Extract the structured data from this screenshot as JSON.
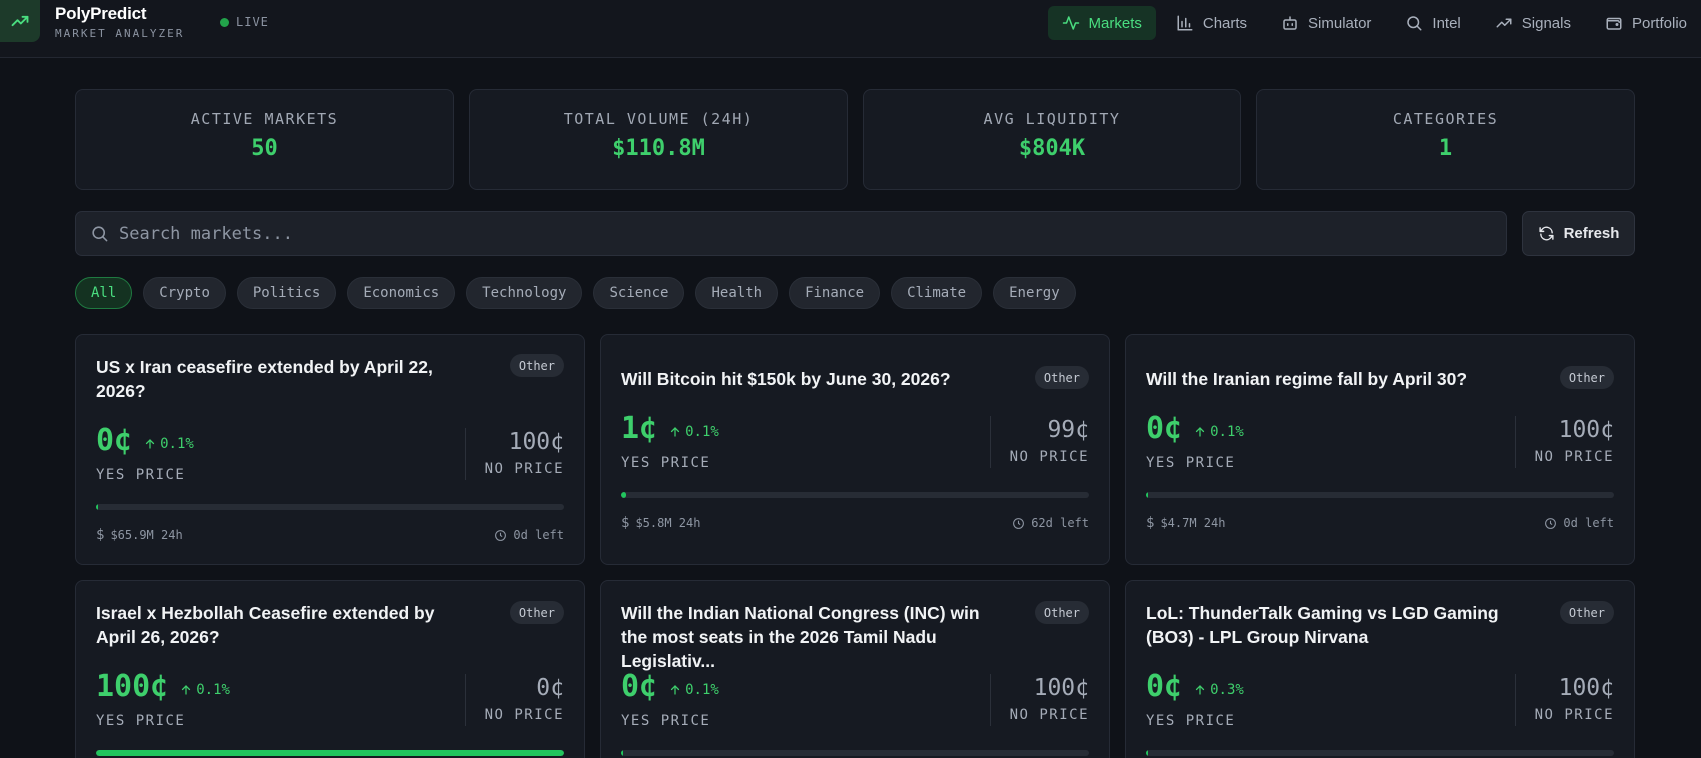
{
  "app": {
    "name": "PolyPredict",
    "subtitle": "MARKET ANALYZER",
    "live_label": "LIVE"
  },
  "nav": [
    {
      "label": "Markets",
      "icon": "activity-icon",
      "active": true
    },
    {
      "label": "Charts",
      "icon": "bar-chart-icon",
      "active": false
    },
    {
      "label": "Simulator",
      "icon": "bot-icon",
      "active": false
    },
    {
      "label": "Intel",
      "icon": "search-icon",
      "active": false
    },
    {
      "label": "Signals",
      "icon": "trending-up-icon",
      "active": false
    },
    {
      "label": "Portfolio",
      "icon": "wallet-icon",
      "active": false
    }
  ],
  "stats": [
    {
      "label": "ACTIVE MARKETS",
      "value": "50"
    },
    {
      "label": "TOTAL VOLUME (24H)",
      "value": "$110.8M"
    },
    {
      "label": "AVG LIQUIDITY",
      "value": "$804K"
    },
    {
      "label": "CATEGORIES",
      "value": "1"
    }
  ],
  "search": {
    "placeholder": "Search markets...",
    "value": ""
  },
  "refresh_label": "Refresh",
  "categories": [
    "All",
    "Crypto",
    "Politics",
    "Economics",
    "Technology",
    "Science",
    "Health",
    "Finance",
    "Climate",
    "Energy"
  ],
  "active_category": "All",
  "markets": [
    {
      "title": "US x Iran ceasefire extended by April 22, 2026?",
      "badge": "Other",
      "yes_price": "0¢",
      "change": "0.1%",
      "yes_label": "YES PRICE",
      "no_price": "100¢",
      "no_label": "NO PRICE",
      "yes_fraction": 0.0,
      "volume": "$65.9M 24h",
      "time_left": "0d left"
    },
    {
      "title": "Will Bitcoin hit $150k by June 30, 2026?",
      "badge": "Other",
      "yes_price": "1¢",
      "change": "0.1%",
      "yes_label": "YES PRICE",
      "no_price": "99¢",
      "no_label": "NO PRICE",
      "yes_fraction": 0.01,
      "volume": "$5.8M 24h",
      "time_left": "62d left"
    },
    {
      "title": "Will the Iranian regime fall by April 30?",
      "badge": "Other",
      "yes_price": "0¢",
      "change": "0.1%",
      "yes_label": "YES PRICE",
      "no_price": "100¢",
      "no_label": "NO PRICE",
      "yes_fraction": 0.0,
      "volume": "$4.7M 24h",
      "time_left": "0d left"
    },
    {
      "title": "Israel x Hezbollah Ceasefire extended by April 26, 2026?",
      "badge": "Other",
      "yes_price": "100¢",
      "change": "0.1%",
      "yes_label": "YES PRICE",
      "no_price": "0¢",
      "no_label": "NO PRICE",
      "yes_fraction": 1.0,
      "volume": "",
      "time_left": ""
    },
    {
      "title": "Will the Indian National Congress (INC) win the most seats in the 2026 Tamil Nadu Legislativ...",
      "badge": "Other",
      "yes_price": "0¢",
      "change": "0.1%",
      "yes_label": "YES PRICE",
      "no_price": "100¢",
      "no_label": "NO PRICE",
      "yes_fraction": 0.0,
      "volume": "",
      "time_left": ""
    },
    {
      "title": "LoL: ThunderTalk Gaming vs LGD Gaming (BO3) - LPL Group Nirvana",
      "badge": "Other",
      "yes_price": "0¢",
      "change": "0.3%",
      "yes_label": "YES PRICE",
      "no_price": "100¢",
      "no_label": "NO PRICE",
      "yes_fraction": 0.0,
      "volume": "",
      "time_left": ""
    }
  ]
}
